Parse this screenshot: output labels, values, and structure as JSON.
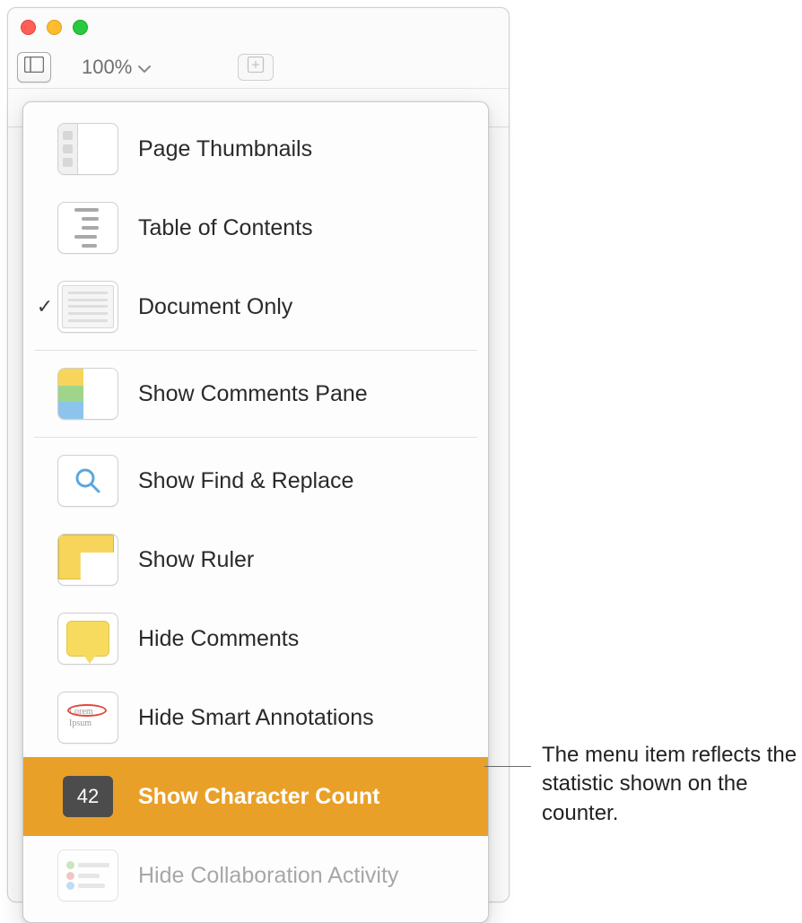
{
  "toolbar": {
    "zoom_value": "100%"
  },
  "menu": {
    "groups": [
      {
        "items": [
          {
            "label": "Page Thumbnails",
            "checked": false
          },
          {
            "label": "Table of Contents",
            "checked": false
          },
          {
            "label": "Document Only",
            "checked": true
          }
        ]
      },
      {
        "items": [
          {
            "label": "Show Comments Pane",
            "checked": false
          }
        ]
      },
      {
        "items": [
          {
            "label": "Show Find & Replace",
            "checked": false
          },
          {
            "label": "Show Ruler",
            "checked": false
          },
          {
            "label": "Hide Comments",
            "checked": false
          },
          {
            "label": "Hide Smart Annotations",
            "checked": false
          },
          {
            "label": "Show Character Count",
            "checked": false,
            "selected": true,
            "badge": "42"
          },
          {
            "label": "Hide Collaboration Activity",
            "checked": false,
            "disabled": true
          }
        ]
      }
    ]
  },
  "smart_annot": {
    "line1": "Lorem",
    "line2": "Ipsum"
  },
  "callout": {
    "text": "The menu item reflects the statistic shown on the counter."
  }
}
